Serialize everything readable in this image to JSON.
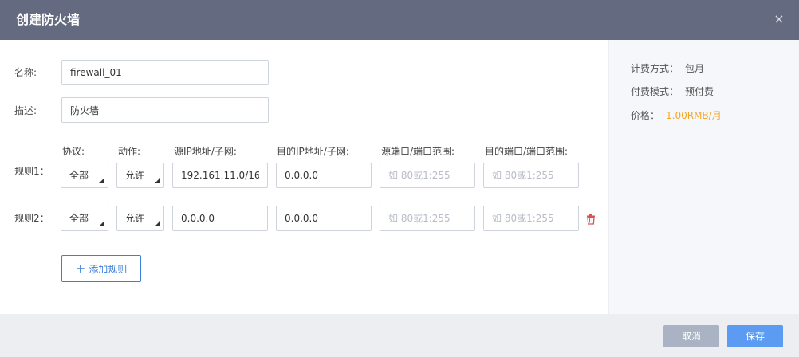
{
  "dialog": {
    "title": "创建防火墙",
    "close_icon": "×"
  },
  "form": {
    "name_label": "名称:",
    "name_value": "firewall_01",
    "desc_label": "描述:",
    "desc_value": "防火墙"
  },
  "rules": {
    "headers": {
      "protocol": "协议:",
      "action": "动作:",
      "source_ip": "源IP地址/子网:",
      "dest_ip": "目的IP地址/子网:",
      "source_port": "源端口/端口范围:",
      "dest_port": "目的端口/端口范围:"
    },
    "port_placeholder": "如 80或1:255",
    "items": [
      {
        "label": "规则1：",
        "protocol": "全部",
        "action": "允许",
        "source_ip": "192.161.11.0/16",
        "dest_ip": "0.0.0.0",
        "source_port": "",
        "dest_port": ""
      },
      {
        "label": "规则2：",
        "protocol": "全部",
        "action": "允许",
        "source_ip": "0.0.0.0",
        "dest_ip": "0.0.0.0",
        "source_port": "",
        "dest_port": ""
      }
    ],
    "add_button": "添加规则"
  },
  "billing": {
    "method_label": "计费方式：",
    "method_value": "包月",
    "mode_label": "付费模式：",
    "mode_value": "预付费",
    "price_label": "价格：",
    "price_value": "1.00RMB/月",
    "price_color": "#f5a623"
  },
  "footer": {
    "cancel_label": "取消",
    "save_label": "保存"
  },
  "colors": {
    "header_bg": "#646a80",
    "accent": "#3d7fd6",
    "save_bg": "#5b9cf2",
    "cancel_bg": "#a9b3c3",
    "danger": "#d9534f"
  }
}
